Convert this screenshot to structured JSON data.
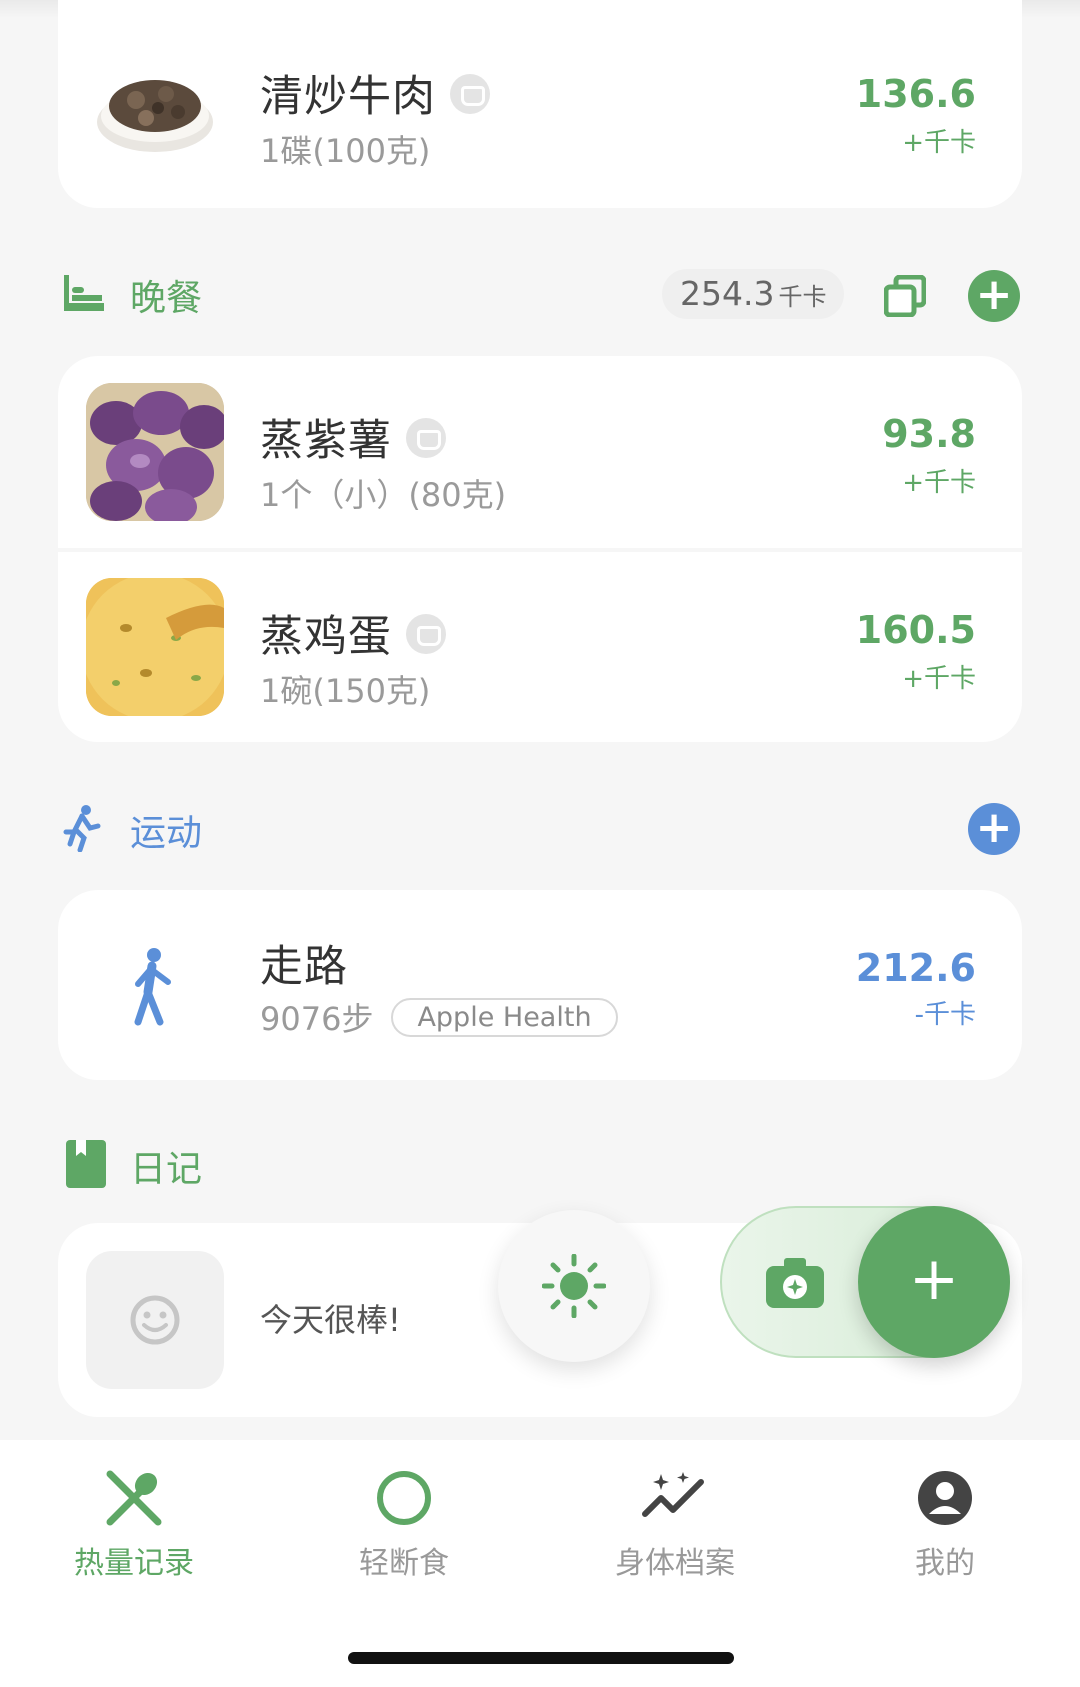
{
  "lunch_last_item": {
    "name": "清炒牛肉",
    "portion": "1碟(100克)",
    "kcal": "136.6",
    "unit": "+千卡"
  },
  "dinner": {
    "title": "晚餐",
    "total": "254.3",
    "total_unit": "千卡",
    "items": [
      {
        "name": "蒸紫薯",
        "portion": "1个（小）(80克)",
        "kcal": "93.8",
        "unit": "+千卡"
      },
      {
        "name": "蒸鸡蛋",
        "portion": "1碗(150克)",
        "kcal": "160.5",
        "unit": "+千卡"
      }
    ]
  },
  "exercise": {
    "title": "运动",
    "items": [
      {
        "name": "走路",
        "steps": "9076步",
        "source": "Apple Health",
        "kcal": "212.6",
        "unit": "-千卡"
      }
    ]
  },
  "diary": {
    "title": "日记",
    "text": "今天很棒!"
  },
  "fab": {
    "plus": "+"
  },
  "tabs": [
    {
      "label": "热量记录"
    },
    {
      "label": "轻断食"
    },
    {
      "label": "身体档案"
    },
    {
      "label": "我的"
    }
  ],
  "colors": {
    "green": "#5ea765",
    "blue": "#5b8fd8"
  }
}
